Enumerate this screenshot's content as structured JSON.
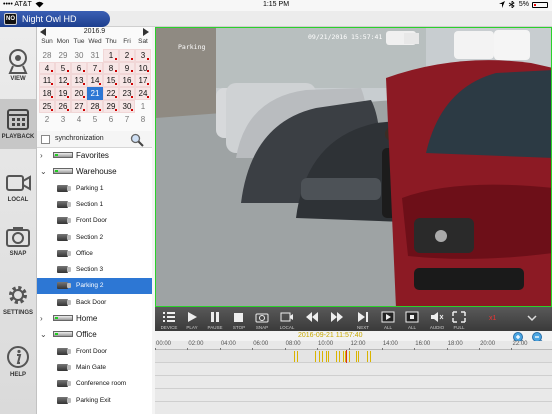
{
  "statusbar": {
    "carrier": "•••• AT&T",
    "time": "1:15 PM",
    "battery": "5%"
  },
  "app": {
    "title": "Night Owl HD",
    "logo_text": "NO"
  },
  "nav": [
    {
      "label": "VIEW",
      "icon": "camera-icon"
    },
    {
      "label": "PLAYBACK",
      "icon": "calendar-icon"
    },
    {
      "label": "LOCAL",
      "icon": "video-icon"
    },
    {
      "label": "SNAP",
      "icon": "snapshot-icon"
    },
    {
      "label": "SETTINGS",
      "icon": "gear-icon"
    },
    {
      "label": "HELP",
      "icon": "info-icon"
    }
  ],
  "calendar": {
    "month": "2016.9",
    "weekdays": [
      "Sun",
      "Mon",
      "Tue",
      "Wed",
      "Thu",
      "Fri",
      "Sat"
    ],
    "weeks": [
      [
        "28",
        "29",
        "30",
        "31",
        "1",
        "2",
        "3"
      ],
      [
        "4",
        "5",
        "6",
        "7",
        "8",
        "9",
        "10"
      ],
      [
        "11",
        "12",
        "13",
        "14",
        "15",
        "16",
        "17"
      ],
      [
        "18",
        "19",
        "20",
        "21",
        "22",
        "23",
        "24"
      ],
      [
        "25",
        "26",
        "27",
        "28",
        "29",
        "30",
        "1"
      ],
      [
        "2",
        "3",
        "4",
        "5",
        "6",
        "7",
        "8"
      ]
    ],
    "selected": "21"
  },
  "sync": {
    "label": "synchronization"
  },
  "tree": [
    {
      "label": "Favorites",
      "type": "group",
      "expanded": false
    },
    {
      "label": "Warehouse",
      "type": "group",
      "expanded": true
    },
    {
      "label": "Parking 1",
      "type": "camera"
    },
    {
      "label": "Section 1",
      "type": "camera"
    },
    {
      "label": "Front Door",
      "type": "camera"
    },
    {
      "label": "Section 2",
      "type": "camera"
    },
    {
      "label": "Office",
      "type": "camera"
    },
    {
      "label": "Section 3",
      "type": "camera"
    },
    {
      "label": "Parking 2",
      "type": "camera",
      "selected": true
    },
    {
      "label": "Back Door",
      "type": "camera"
    },
    {
      "label": "Home",
      "type": "group",
      "expanded": false
    },
    {
      "label": "Office",
      "type": "group",
      "expanded": true
    },
    {
      "label": "Front Door",
      "type": "camera"
    },
    {
      "label": "Main Gate",
      "type": "camera"
    },
    {
      "label": "Conference room",
      "type": "camera"
    },
    {
      "label": "Parking Exit",
      "type": "camera"
    }
  ],
  "video": {
    "label": "Parking",
    "timestamp": "09/21/2016 15:57:41",
    "border_color": "#2bd12b"
  },
  "controls": [
    {
      "label": "DEVICE",
      "icon": "list-icon"
    },
    {
      "label": "PLAY",
      "icon": "play-icon"
    },
    {
      "label": "PAUSE",
      "icon": "pause-icon"
    },
    {
      "label": "STOP",
      "icon": "stop-icon"
    },
    {
      "label": "SNAP",
      "icon": "snapshot-icon"
    },
    {
      "label": "LOCAL",
      "icon": "record-icon"
    },
    {
      "label": "",
      "icon": "rewind-icon"
    },
    {
      "label": "",
      "icon": "fast-forward-icon"
    },
    {
      "label": "NEXT",
      "icon": "next-icon"
    },
    {
      "label": "ALL",
      "icon": "play-all-icon"
    },
    {
      "label": "ALL",
      "icon": "stop-all-icon"
    },
    {
      "label": "AUDIO",
      "icon": "mute-icon"
    },
    {
      "label": "FULL",
      "icon": "fullscreen-icon"
    }
  ],
  "speed": "x1",
  "timeline": {
    "datetime": "2016-09-21 11:57:40",
    "hours": [
      "00:00",
      "02:00",
      "04:00",
      "06:00",
      "08:00",
      "10:00",
      "12:00",
      "14:00",
      "16:00",
      "18:00",
      "20:00",
      "22:00"
    ],
    "recording_color": "#d9b400",
    "recordings_hours": [
      8.6,
      8.75,
      9.9,
      10.1,
      10.3,
      10.55,
      10.7,
      11.2,
      11.35,
      11.6,
      11.75,
      11.95,
      12.4,
      12.55,
      13.1,
      13.25
    ]
  }
}
